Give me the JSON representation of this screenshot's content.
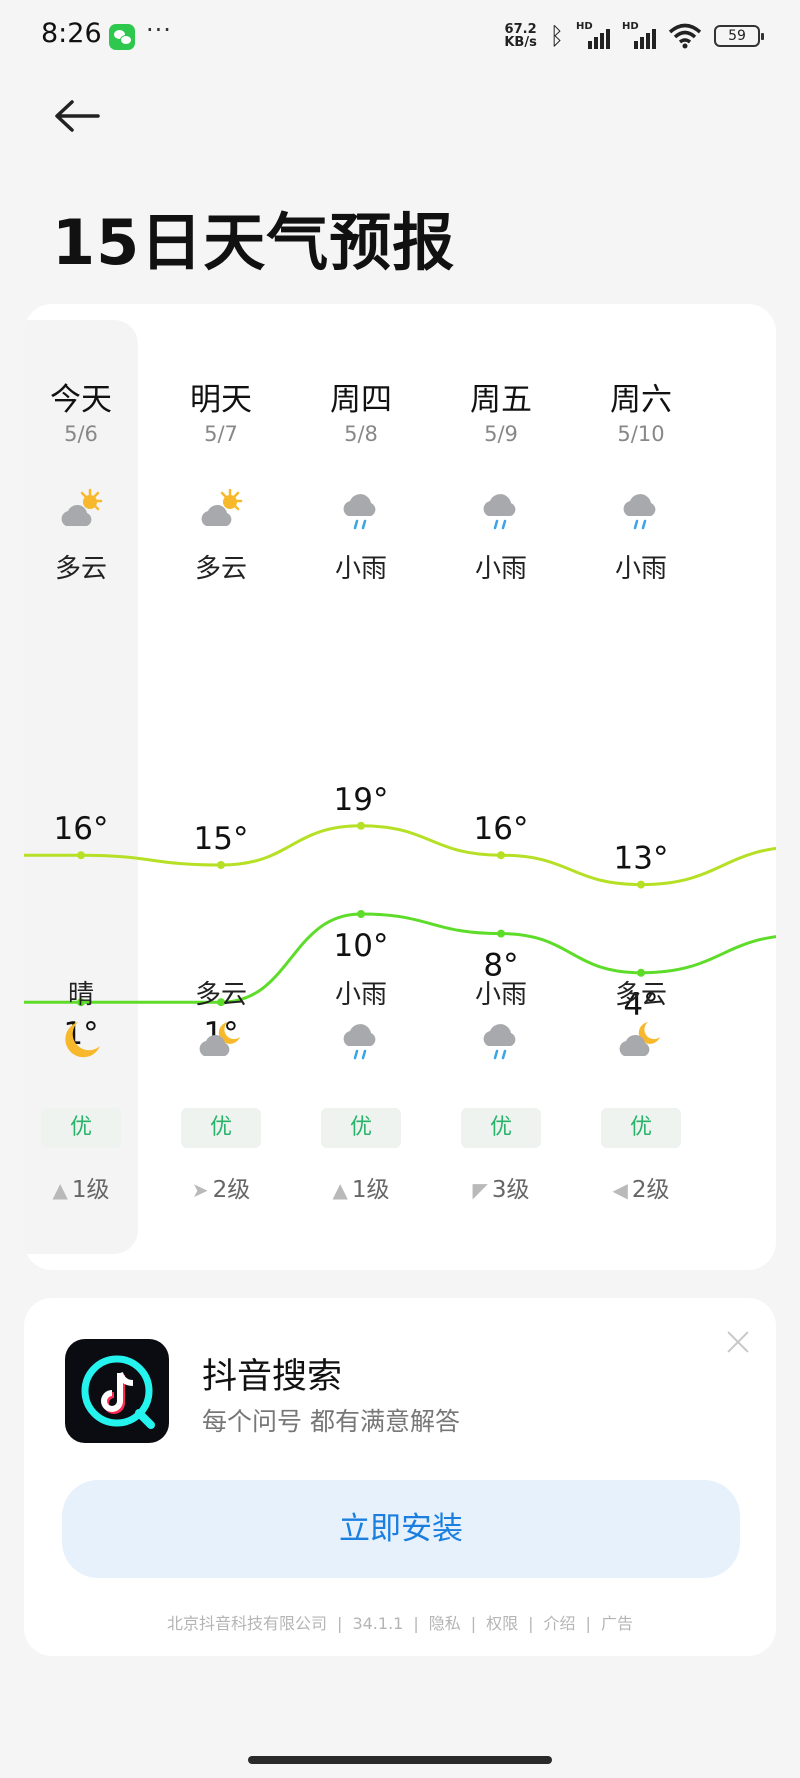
{
  "status_bar": {
    "time": "8:26",
    "more": "···",
    "net_speed_value": "67.2",
    "net_speed_unit": "KB/s",
    "sim1": "HD",
    "sim2": "HD",
    "battery": "59"
  },
  "header": {
    "title": "15日天气预报"
  },
  "forecast": {
    "days": [
      {
        "name": "今天",
        "date": "5/6",
        "day_condition": "多云",
        "day_icon": "partly-cloudy-day-icon",
        "high": "16°",
        "low": "1°",
        "night_condition": "晴",
        "night_icon": "moon-icon",
        "aqi": "优",
        "wind_arrow": "▲",
        "wind_level": "1级"
      },
      {
        "name": "明天",
        "date": "5/7",
        "day_condition": "多云",
        "day_icon": "partly-cloudy-day-icon",
        "high": "15°",
        "low": "1°",
        "night_condition": "多云",
        "night_icon": "partly-cloudy-night-icon",
        "aqi": "优",
        "wind_arrow": "➤",
        "wind_level": "2级"
      },
      {
        "name": "周四",
        "date": "5/8",
        "day_condition": "小雨",
        "day_icon": "light-rain-icon",
        "high": "19°",
        "low": "10°",
        "night_condition": "小雨",
        "night_icon": "light-rain-icon",
        "aqi": "优",
        "wind_arrow": "▲",
        "wind_level": "1级"
      },
      {
        "name": "周五",
        "date": "5/9",
        "day_condition": "小雨",
        "day_icon": "light-rain-icon",
        "high": "16°",
        "low": "8°",
        "night_condition": "小雨",
        "night_icon": "light-rain-icon",
        "aqi": "优",
        "wind_arrow": "◤",
        "wind_level": "3级"
      },
      {
        "name": "周六",
        "date": "5/10",
        "day_condition": "小雨",
        "day_icon": "light-rain-icon",
        "high": "13°",
        "low": "4°",
        "night_condition": "多云",
        "night_icon": "partly-cloudy-night-icon",
        "aqi": "优",
        "wind_arrow": "◀",
        "wind_level": "2级"
      }
    ],
    "high_temps": [
      16,
      15,
      19,
      16,
      13
    ],
    "low_temps": [
      1,
      1,
      10,
      8,
      4
    ],
    "high_line_color": "#b5e025",
    "low_line_color": "#5edc2a"
  },
  "ad": {
    "app_name": "抖音搜索",
    "app_desc": "每个问号 都有满意解答",
    "install_label": "立即安装",
    "footer": [
      "北京抖音科技有限公司",
      "34.1.1",
      "隐私",
      "权限",
      "介绍",
      "广告"
    ],
    "brand_cyan": "#25f4ee",
    "brand_red": "#fe2c55"
  }
}
